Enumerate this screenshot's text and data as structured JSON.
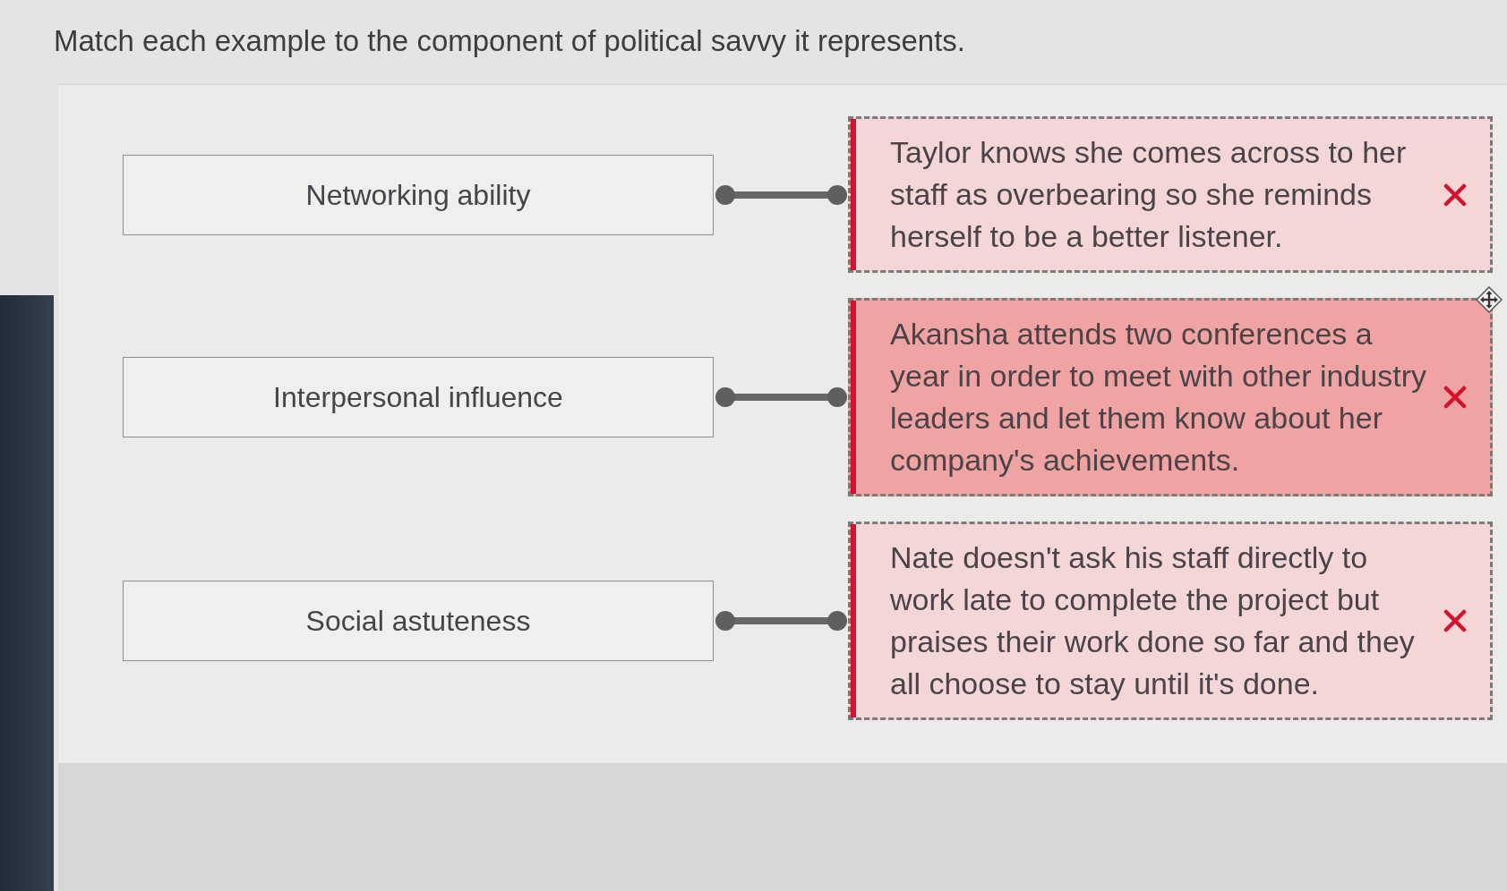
{
  "instruction": "Match each example to the component of political savvy it represents.",
  "pairs": [
    {
      "term": "Networking ability",
      "example": "Taylor knows she comes across to her staff as overbearing so she reminds herself to be a better listener.",
      "correct": false,
      "selected": false
    },
    {
      "term": "Interpersonal influence",
      "example": "Akansha attends two conferences a year in order to meet with other industry leaders and let them know about her company's achievements.",
      "correct": false,
      "selected": true
    },
    {
      "term": "Social astuteness",
      "example": "Nate doesn't ask his staff directly to work late to complete the project but praises their work done so far and they all choose to stay until it's done.",
      "correct": false,
      "selected": false
    }
  ]
}
